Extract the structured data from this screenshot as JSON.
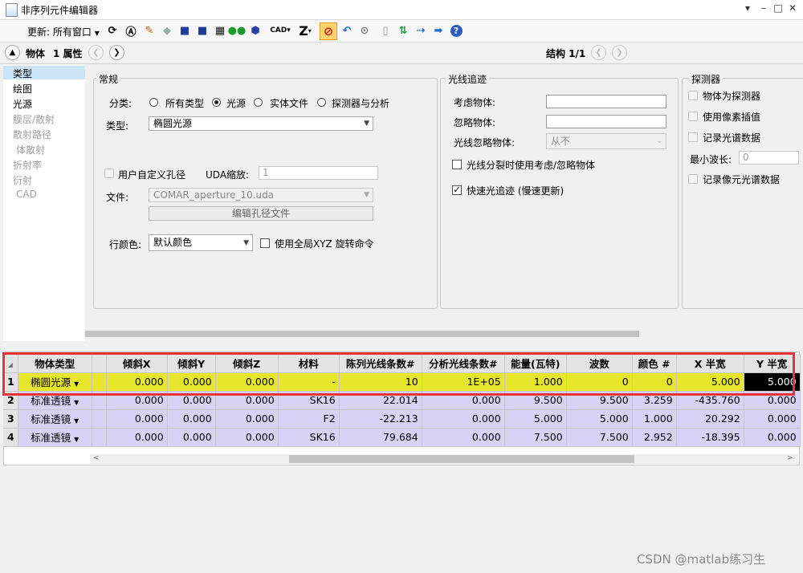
{
  "window": {
    "title": "非序列元件编辑器"
  },
  "toolbar": {
    "update_label": "更新:",
    "update_value": "所有窗口",
    "cad_label": "CAD",
    "z_label": "Z"
  },
  "objbar": {
    "object_label": "物体",
    "property_label": "1 属性",
    "structure_label": "结构 1/1"
  },
  "left_nav": [
    "类型",
    "绘图",
    "光源",
    "膜层/散射",
    "散射路径",
    "体散射",
    "折射率",
    "衍射",
    "CAD"
  ],
  "general": {
    "title": "常规",
    "category_label": "分类:",
    "radios": [
      "所有类型",
      "光源",
      "实体文件",
      "探测器与分析"
    ],
    "type_label": "类型:",
    "type_value": "椭圆光源",
    "user_aperture_label": "用户自定义孔径",
    "uda_scale_label": "UDA缩放:",
    "uda_scale_value": "1",
    "file_label": "文件:",
    "file_value": "COMAR_aperture_10.uda",
    "edit_aperture_button": "编辑孔径文件",
    "row_color_label": "行颜色:",
    "row_color_value": "默认颜色",
    "global_xyz_label": "使用全局XYZ 旋转命令"
  },
  "raytrace": {
    "title": "光线追迹",
    "consider_label": "考虑物体:",
    "ignore_label": "忽略物体:",
    "ray_ignore_label": "光线忽略物体:",
    "ray_ignore_value": "从不",
    "split_label": "光线分裂时使用考虑/忽略物体",
    "fast_label": "快速光追迹 (慢速更新)"
  },
  "detector": {
    "title": "探测器",
    "items": [
      "物体为探测器",
      "使用像素插值",
      "记录光谱数据"
    ],
    "min_wave_label": "最小波长:",
    "min_wave_value": "0",
    "pixel_spec_label": "记录像元光谱数据"
  },
  "grid": {
    "headers": [
      "物体类型",
      "倾斜X",
      "倾斜Y",
      "倾斜Z",
      "材料",
      "陈列光线条数#",
      "分析光线条数#",
      "能量(瓦特)",
      "波数",
      "颜色 #",
      "X 半宽",
      "Y 半宽"
    ],
    "rows": [
      {
        "n": "1",
        "type": "椭圆光源",
        "cells": [
          "0.000",
          "0.000",
          "0.000",
          "-",
          "10",
          "1E+05",
          "1.000",
          "0",
          "0",
          "5.000",
          "5.000"
        ]
      },
      {
        "n": "2",
        "type": "标准透镜",
        "cells": [
          "0.000",
          "0.000",
          "0.000",
          "SK16",
          "22.014",
          "0.000",
          "9.500",
          "9.500",
          "3.259",
          "-435.760",
          "0.000"
        ]
      },
      {
        "n": "3",
        "type": "标准透镜",
        "cells": [
          "0.000",
          "0.000",
          "0.000",
          "F2",
          "-22.213",
          "0.000",
          "5.000",
          "5.000",
          "1.000",
          "20.292",
          "0.000"
        ]
      },
      {
        "n": "4",
        "type": "标准透镜",
        "cells": [
          "0.000",
          "0.000",
          "0.000",
          "SK16",
          "79.684",
          "0.000",
          "7.500",
          "7.500",
          "2.952",
          "-18.395",
          "0.000"
        ]
      }
    ]
  },
  "watermark": "CSDN @matlab练习生"
}
